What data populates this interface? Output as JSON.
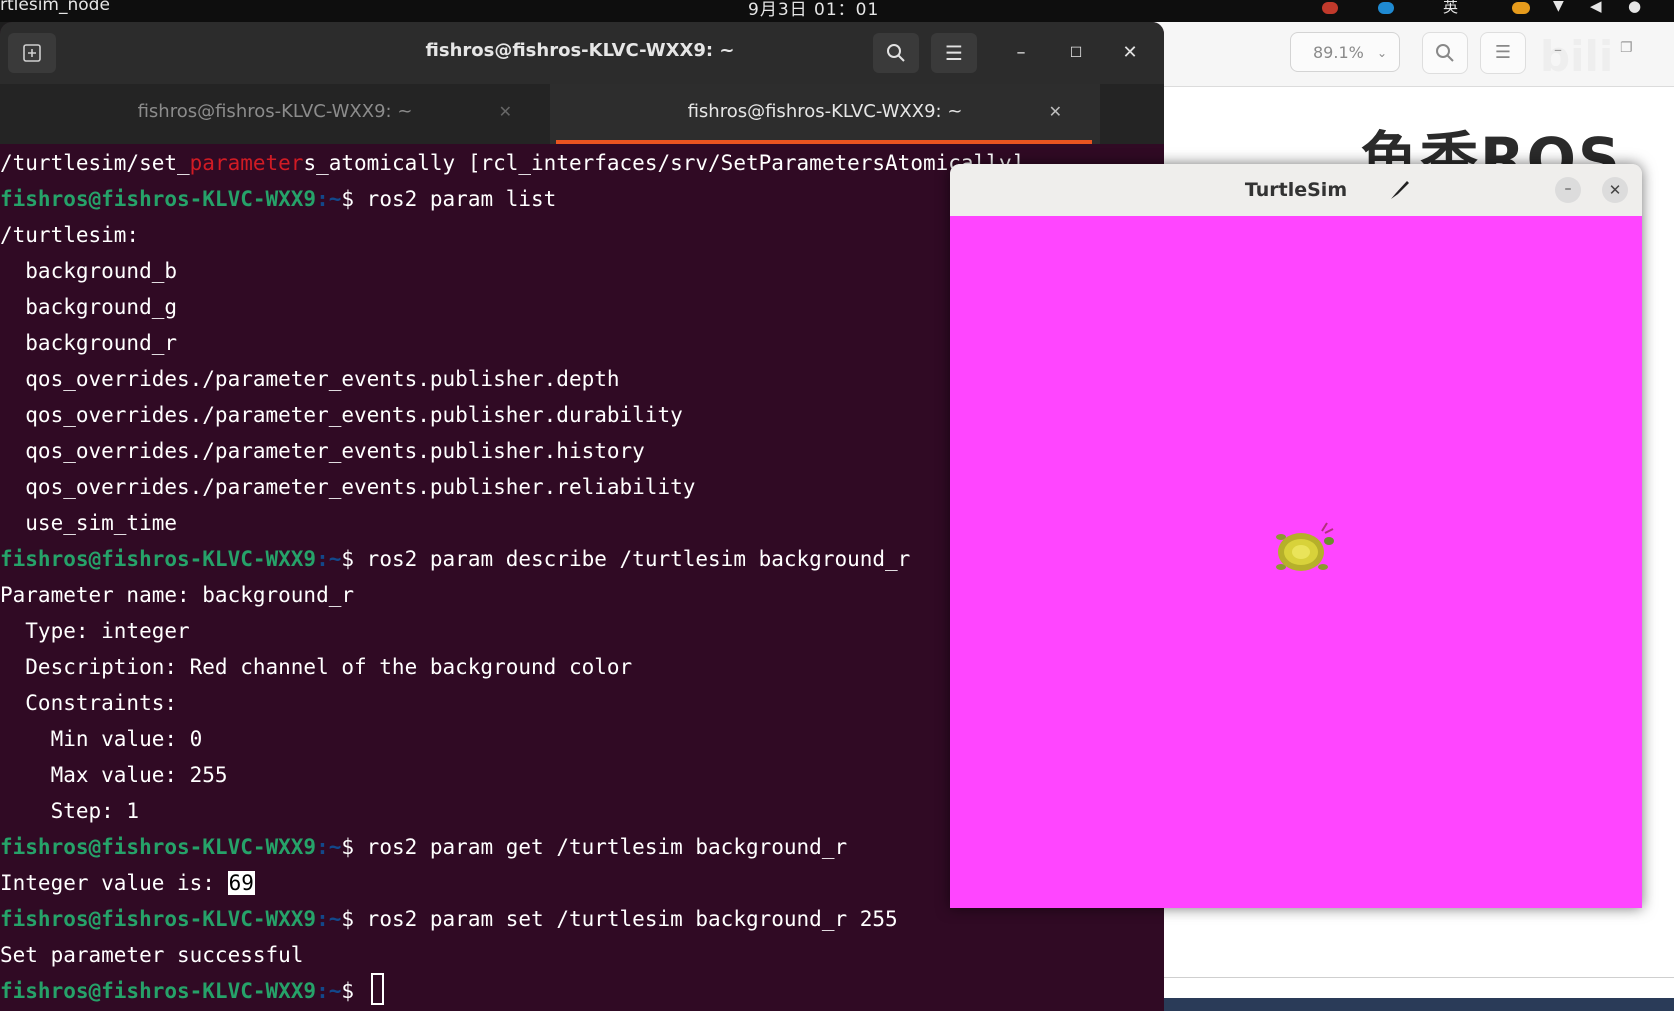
{
  "system_bar": {
    "app_name": "rtlesim_node",
    "clock": "9月3日  01：01",
    "ime": "英"
  },
  "viewer": {
    "zoom": "89.1%",
    "logo": "鱼香ROS"
  },
  "terminal": {
    "window_title": "fishros@fishros-KLVC-WXX9: ~",
    "tabs": [
      {
        "label": "fishros@fishros-KLVC-WXX9: ~",
        "active": false
      },
      {
        "label": "fishros@fishros-KLVC-WXX9: ~",
        "active": true
      }
    ],
    "prompt_user": "fishros@fishros-KLVC-WXX9",
    "prompt_path": ":~",
    "prompt_symbol": "$ ",
    "lines": [
      {
        "kind": "partial",
        "pre": "/turtlesim/set_",
        "hl": "parameter",
        "post": "s_atomically [rcl_interfaces/srv/SetParametersAtomically]"
      },
      {
        "kind": "cmd",
        "text": "ros2 param list"
      },
      {
        "kind": "out",
        "text": "/turtlesim:"
      },
      {
        "kind": "out",
        "text": "  background_b"
      },
      {
        "kind": "out",
        "text": "  background_g"
      },
      {
        "kind": "out",
        "text": "  background_r"
      },
      {
        "kind": "out",
        "text": "  qos_overrides./parameter_events.publisher.depth"
      },
      {
        "kind": "out",
        "text": "  qos_overrides./parameter_events.publisher.durability"
      },
      {
        "kind": "out",
        "text": "  qos_overrides./parameter_events.publisher.history"
      },
      {
        "kind": "out",
        "text": "  qos_overrides./parameter_events.publisher.reliability"
      },
      {
        "kind": "out",
        "text": "  use_sim_time"
      },
      {
        "kind": "cmd",
        "text": "ros2 param describe /turtlesim background_r"
      },
      {
        "kind": "out",
        "text": "Parameter name: background_r"
      },
      {
        "kind": "out",
        "text": "  Type: integer"
      },
      {
        "kind": "out",
        "text": "  Description: Red channel of the background color"
      },
      {
        "kind": "out",
        "text": "  Constraints:"
      },
      {
        "kind": "out",
        "text": "    Min value: 0"
      },
      {
        "kind": "out",
        "text": "    Max value: 255"
      },
      {
        "kind": "out",
        "text": "    Step: 1"
      },
      {
        "kind": "cmd",
        "text": "ros2 param get /turtlesim background_r"
      },
      {
        "kind": "selected",
        "pre": "Integer value is: ",
        "sel": "69"
      },
      {
        "kind": "cmd",
        "text": "ros2 param set /turtlesim background_r 255"
      },
      {
        "kind": "out",
        "text": "Set parameter successful"
      },
      {
        "kind": "cursor",
        "text": ""
      }
    ]
  },
  "turtlesim": {
    "title": "TurtleSim",
    "background_color": "#ff45ff"
  },
  "colors": {
    "terminal_bg": "#300a24",
    "prompt_user": "#26a269",
    "highlight": "#d01b24",
    "tab_accent": "#e95420"
  }
}
